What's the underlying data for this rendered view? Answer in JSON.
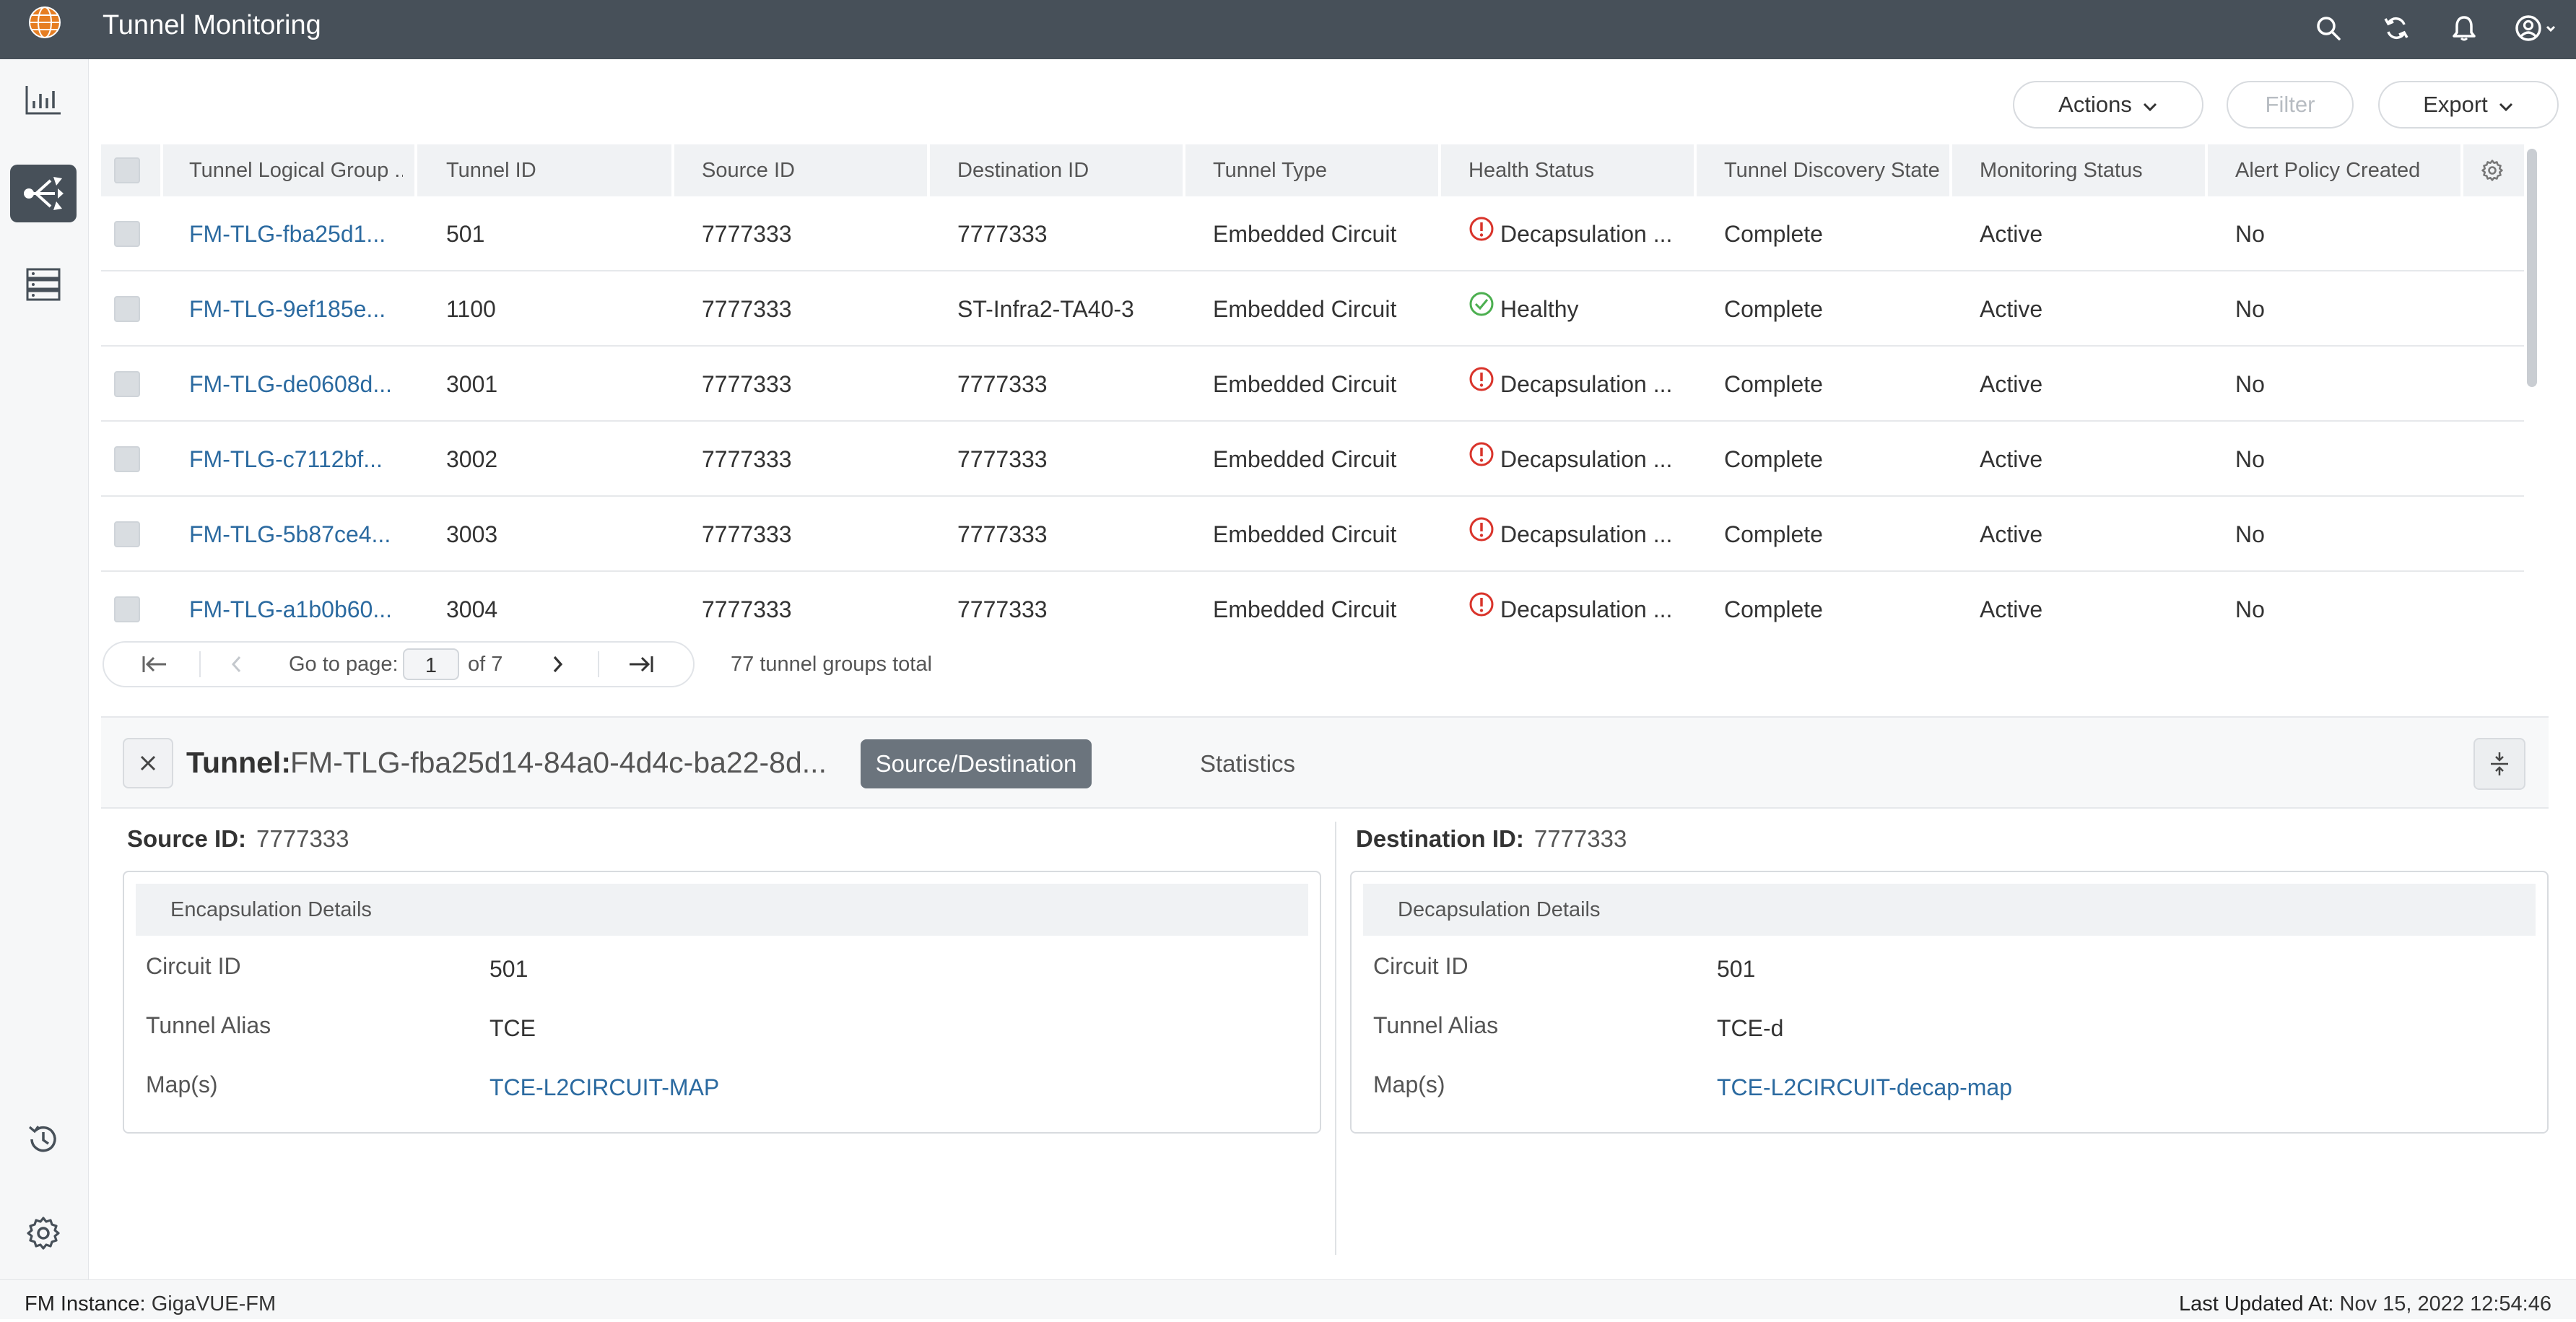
{
  "app": {
    "title": "Tunnel Monitoring",
    "logo_icon": "globe-logo-icon",
    "accent_color": "#475059",
    "link_color": "#2b6aa0",
    "error_color": "#d9342b",
    "success_color": "#4caf50"
  },
  "topbar_icons": [
    "search-icon",
    "refresh-icon",
    "bell-icon",
    "user-icon"
  ],
  "nav": [
    "dashboard-chart-icon",
    "tunnel-icon",
    "inventory-icon",
    "history-icon",
    "settings-icon"
  ],
  "toolbar": {
    "actions_label": "Actions",
    "filter_label": "Filter",
    "export_label": "Export"
  },
  "table": {
    "headers": [
      "Tunnel Logical Group ...",
      "Tunnel ID",
      "Source ID",
      "Destination ID",
      "Tunnel Type",
      "Health Status",
      "Tunnel Discovery State",
      "Monitoring Status",
      "Alert Policy Created"
    ],
    "rows": [
      {
        "group": "FM-TLG-fba25d1...",
        "tunnel_id": "501",
        "source_id": "7777333",
        "dest_id": "7777333",
        "type": "Embedded Circuit",
        "health": "Decapsulation ...",
        "health_state": "error",
        "discovery": "Complete",
        "monitoring": "Active",
        "alert": "No"
      },
      {
        "group": "FM-TLG-9ef185e...",
        "tunnel_id": "1100",
        "source_id": "7777333",
        "dest_id": "ST-Infra2-TA40-3",
        "type": "Embedded Circuit",
        "health": "Healthy",
        "health_state": "ok",
        "discovery": "Complete",
        "monitoring": "Active",
        "alert": "No"
      },
      {
        "group": "FM-TLG-de0608d...",
        "tunnel_id": "3001",
        "source_id": "7777333",
        "dest_id": "7777333",
        "type": "Embedded Circuit",
        "health": "Decapsulation ...",
        "health_state": "error",
        "discovery": "Complete",
        "monitoring": "Active",
        "alert": "No"
      },
      {
        "group": "FM-TLG-c7112bf...",
        "tunnel_id": "3002",
        "source_id": "7777333",
        "dest_id": "7777333",
        "type": "Embedded Circuit",
        "health": "Decapsulation ...",
        "health_state": "error",
        "discovery": "Complete",
        "monitoring": "Active",
        "alert": "No"
      },
      {
        "group": "FM-TLG-5b87ce4...",
        "tunnel_id": "3003",
        "source_id": "7777333",
        "dest_id": "7777333",
        "type": "Embedded Circuit",
        "health": "Decapsulation ...",
        "health_state": "error",
        "discovery": "Complete",
        "monitoring": "Active",
        "alert": "No"
      },
      {
        "group": "FM-TLG-a1b0b60...",
        "tunnel_id": "3004",
        "source_id": "7777333",
        "dest_id": "7777333",
        "type": "Embedded Circuit",
        "health": "Decapsulation ...",
        "health_state": "error",
        "discovery": "Complete",
        "monitoring": "Active",
        "alert": "No"
      }
    ]
  },
  "pagination": {
    "go_to_label": "Go to page:",
    "current_page": "1",
    "of_label": "of 7",
    "total_label": "77 tunnel groups total"
  },
  "detail": {
    "tunnel_label": "Tunnel:",
    "tunnel_name": "FM-TLG-fba25d14-84a0-4d4c-ba22-8d...",
    "tab_active": "Source/Destination",
    "tab_other": "Statistics",
    "source": {
      "id_label": "Source ID:",
      "id_value": "7777333",
      "card_title": "Encapsulation Details",
      "circuit_label": "Circuit ID",
      "circuit_value": "501",
      "alias_label": "Tunnel Alias",
      "alias_value": "TCE",
      "maps_label": "Map(s)",
      "maps_value": "TCE-L2CIRCUIT-MAP"
    },
    "destination": {
      "id_label": "Destination ID:",
      "id_value": "7777333",
      "card_title": "Decapsulation Details",
      "circuit_label": "Circuit ID",
      "circuit_value": "501",
      "alias_label": "Tunnel Alias",
      "alias_value": "TCE-d",
      "maps_label": "Map(s)",
      "maps_value": "TCE-L2CIRCUIT-decap-map"
    }
  },
  "footer": {
    "instance_label": "FM Instance:",
    "instance_value": "GigaVUE-FM",
    "updated_label": "Last Updated At:",
    "updated_value": "Nov 15, 2022 12:54:46"
  }
}
